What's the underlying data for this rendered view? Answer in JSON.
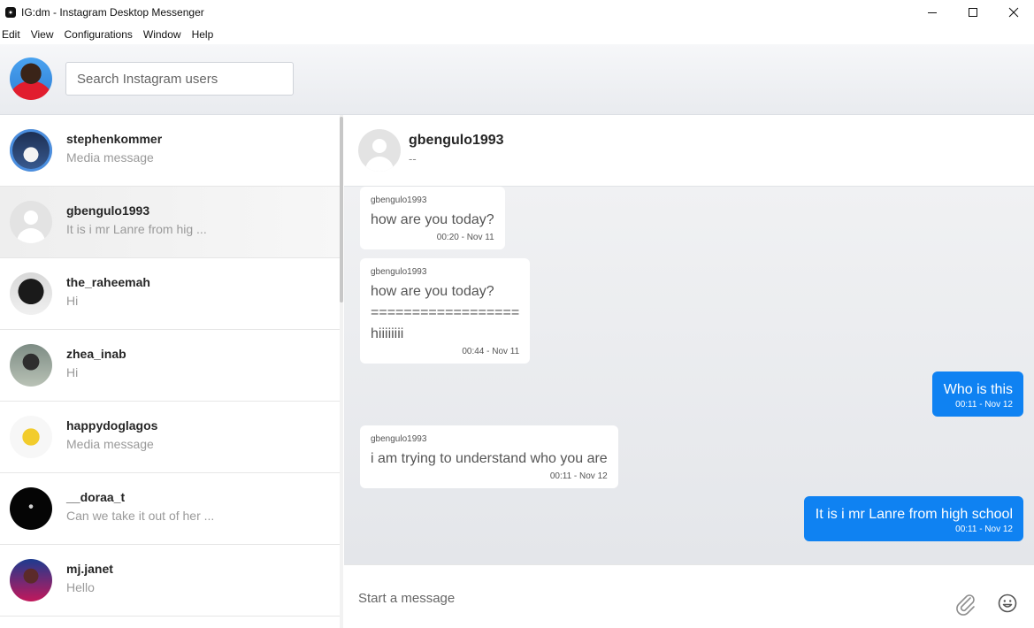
{
  "window": {
    "title": "IG:dm - Instagram Desktop Messenger"
  },
  "menu": [
    "Edit",
    "View",
    "Configurations",
    "Window",
    "Help"
  ],
  "search": {
    "placeholder": "Search Instagram users"
  },
  "conversations": [
    {
      "username": "stephenkommer",
      "preview": "Media message"
    },
    {
      "username": "gbengulo1993",
      "preview": "It is i mr Lanre from hig ..."
    },
    {
      "username": "the_raheemah",
      "preview": "Hi"
    },
    {
      "username": "zhea_inab",
      "preview": "Hi"
    },
    {
      "username": "happydoglagos",
      "preview": "Media message"
    },
    {
      "username": "__doraa_t",
      "preview": "Can we take it out of her ..."
    },
    {
      "username": "mj.janet",
      "preview": "Hello"
    }
  ],
  "chat": {
    "username": "gbengulo1993",
    "status": "--",
    "messages": [
      {
        "sender": "gbengulo1993",
        "text": "how are you today?",
        "time": "00:20 - Nov 11"
      },
      {
        "sender": "gbengulo1993",
        "text": "how are you today?\n==================\nhiiiiiiii",
        "time": "00:44 - Nov 11"
      },
      {
        "text": "Who is this",
        "time": "00:11 - Nov 12"
      },
      {
        "sender": "gbengulo1993",
        "text": "i am trying to understand who you are",
        "time": "00:11 - Nov 12"
      },
      {
        "text": "It is i mr Lanre from high school",
        "time": "00:11 - Nov 12"
      }
    ]
  },
  "composer": {
    "placeholder": "Start a message"
  },
  "icons": {
    "attach": "paperclip-icon",
    "emoji": "smiley-icon",
    "accent": "#0f82f2"
  }
}
